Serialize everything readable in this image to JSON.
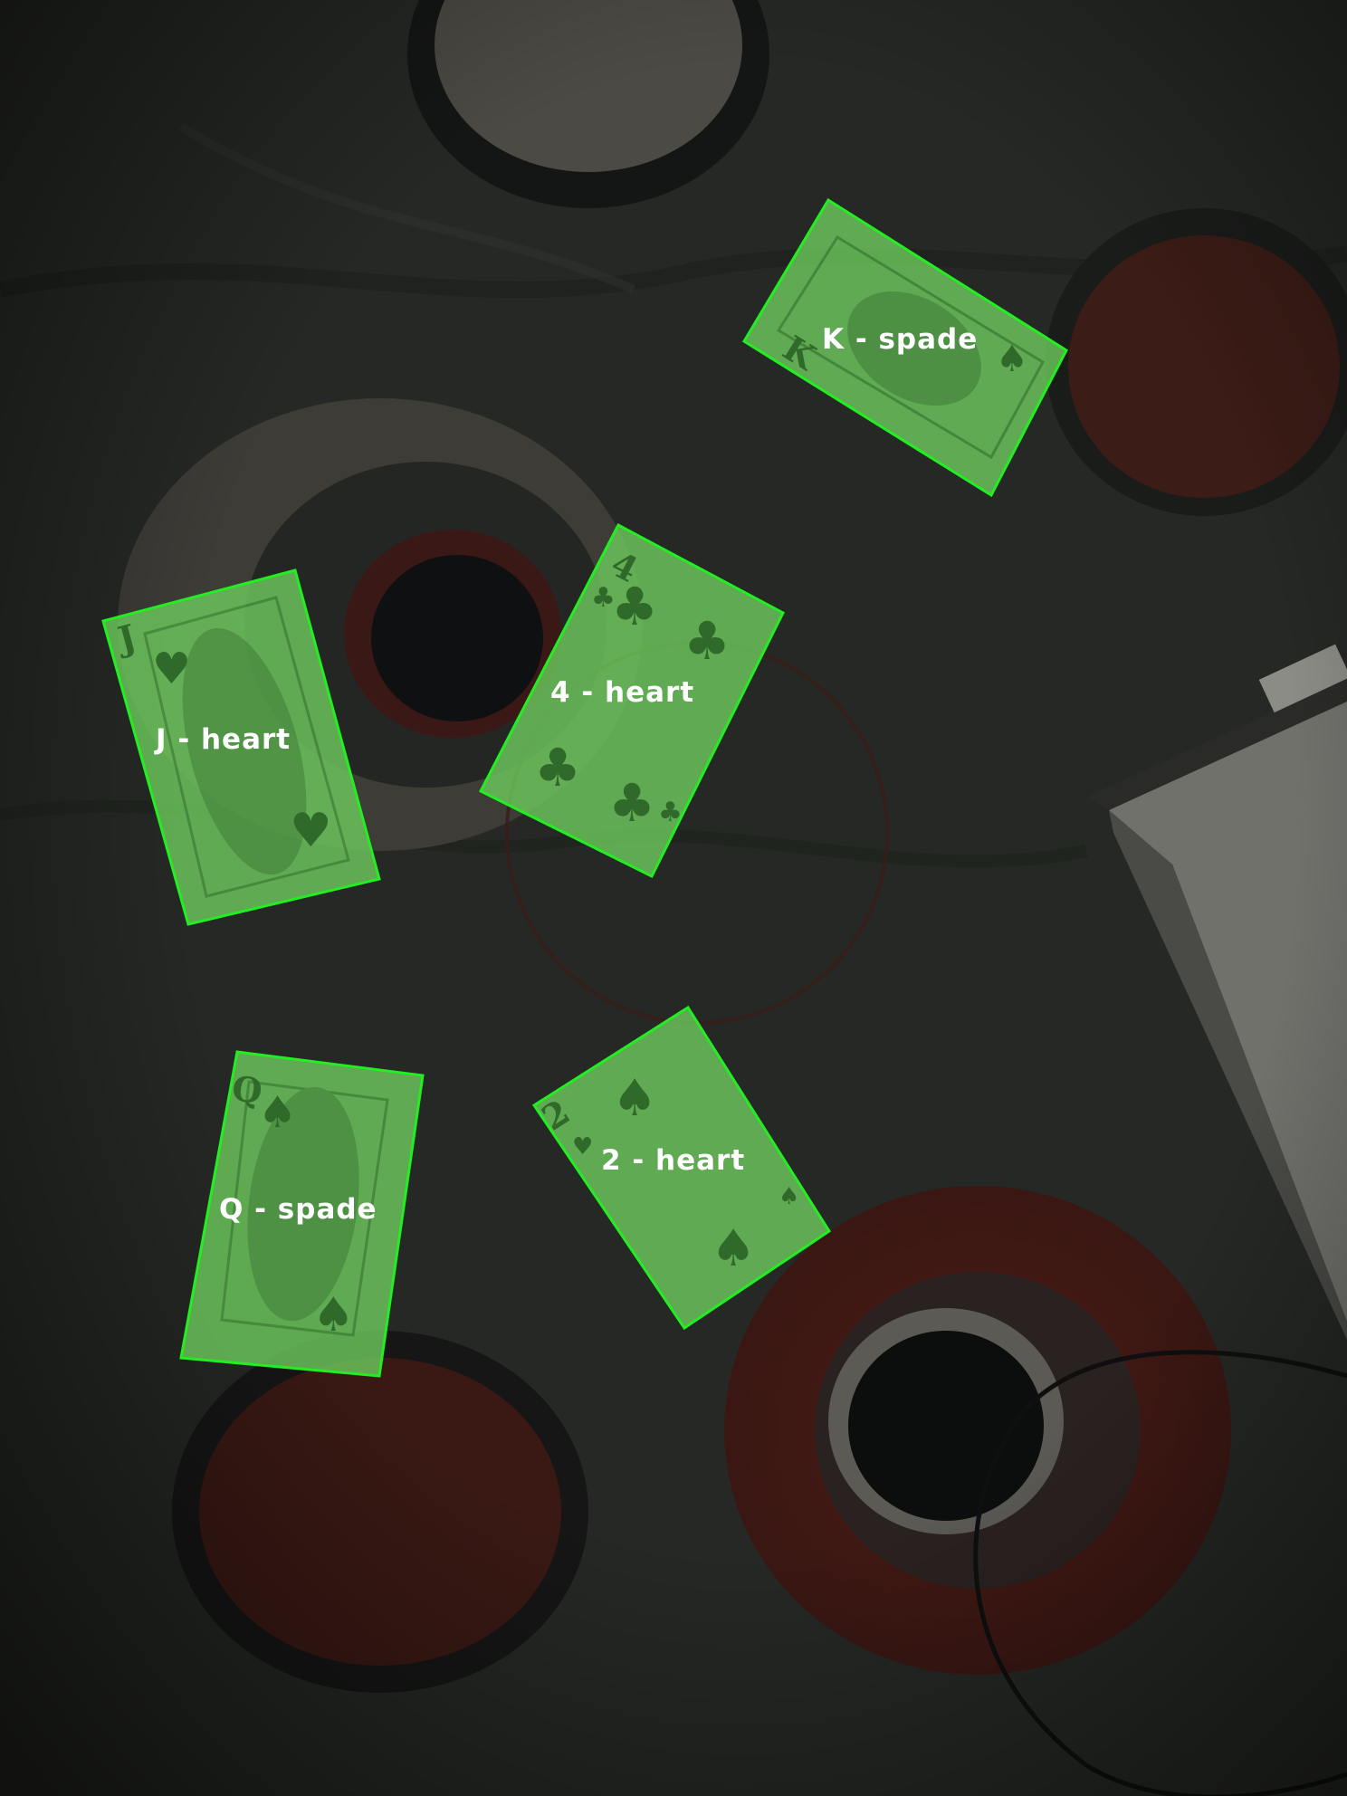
{
  "detections": [
    {
      "id": "k-spade",
      "label": "K - spade",
      "rank": "K",
      "corner_suit": "♠"
    },
    {
      "id": "4-heart",
      "label": "4 - heart",
      "rank": "4",
      "corner_suit": "♣"
    },
    {
      "id": "j-heart",
      "label": "J - heart",
      "rank": "J",
      "corner_suit": "♥"
    },
    {
      "id": "q-spade",
      "label": "Q - spade",
      "rank": "Q",
      "corner_suit": "♠"
    },
    {
      "id": "2-heart",
      "label": "2 - heart",
      "rank": "2",
      "corner_suit": "♥"
    }
  ],
  "colors": {
    "detection_outline": "#22ee22",
    "detection_fill": "#6fcf5f",
    "label_text": "#ffffff",
    "card_ink": "#2f6a2a",
    "background": "#1c1e1c"
  }
}
